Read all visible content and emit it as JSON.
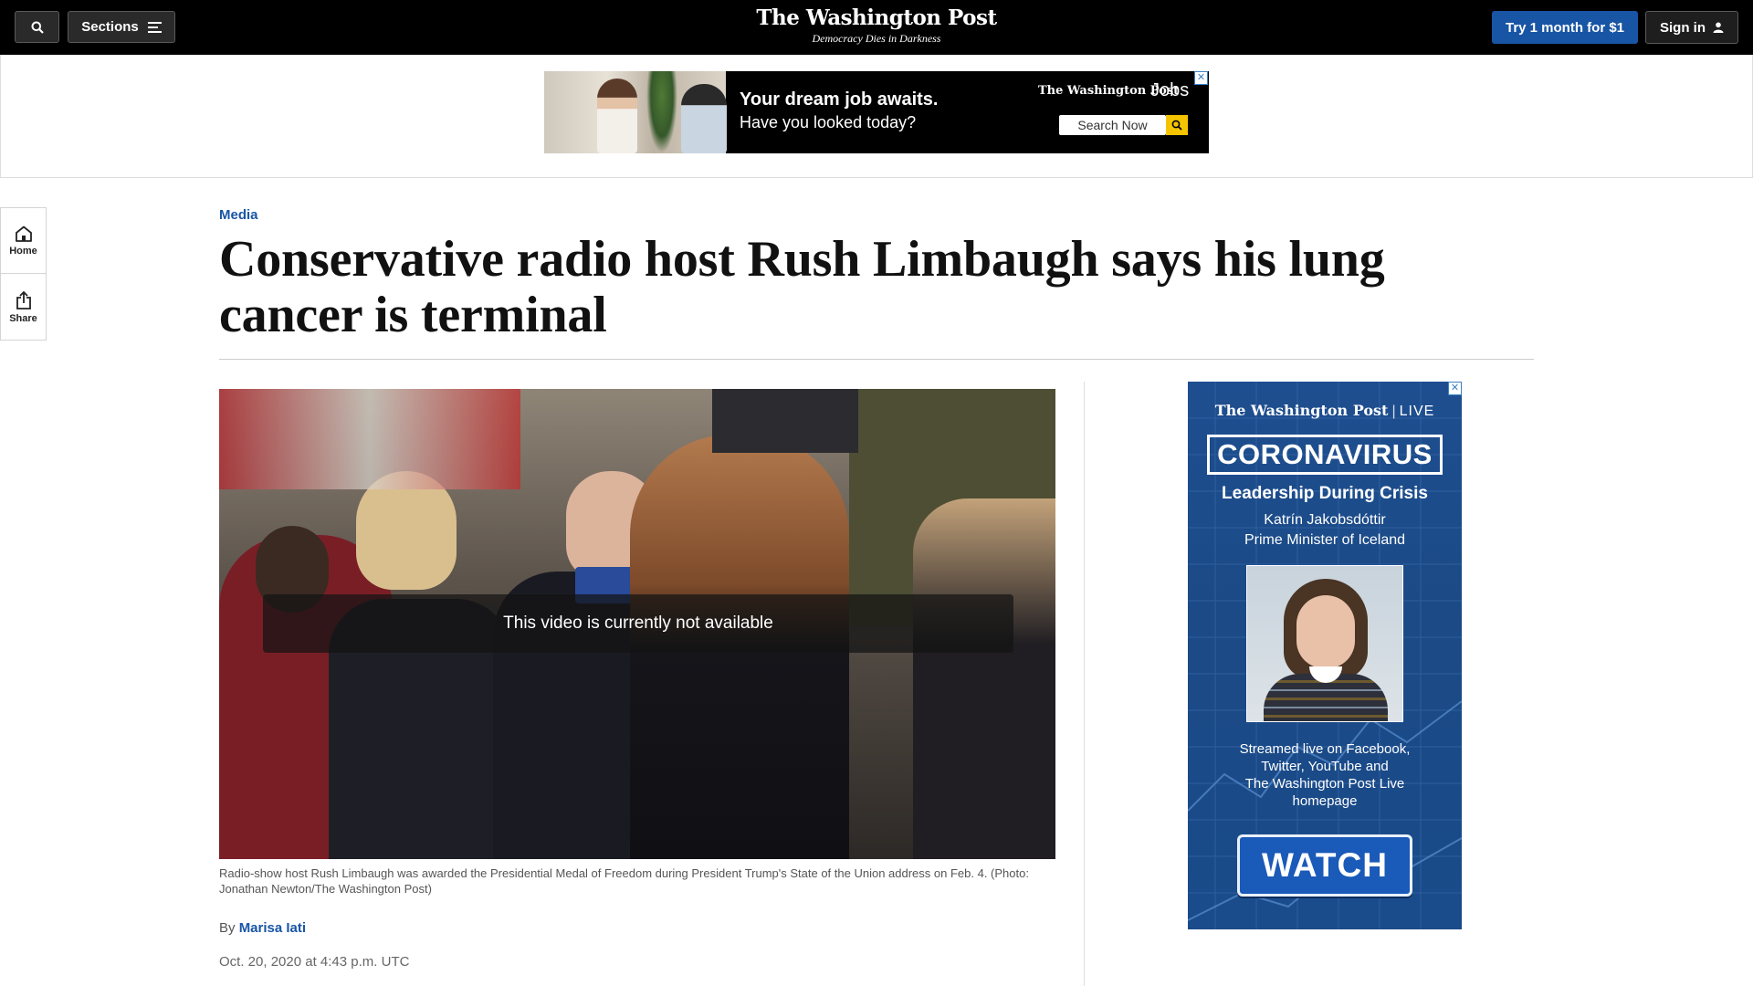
{
  "topbar": {
    "sections_label": "Sections",
    "logo": "The Washington Post",
    "tagline": "Democracy Dies in Darkness",
    "subscribe_label": "Try 1 month for $1",
    "signin_label": "Sign in"
  },
  "top_ad": {
    "headline": "Your dream job awaits.",
    "subline": "Have you looked today?",
    "brand": "The Washington Post",
    "brand_product": "Jobs",
    "search_label": "Search Now",
    "close_glyph": "✕"
  },
  "rail": {
    "home_label": "Home",
    "share_label": "Share"
  },
  "article": {
    "kicker": "Media",
    "headline": "Conservative radio host Rush Limbaugh says his lung cancer is terminal",
    "video_message": "This video is currently not available",
    "caption": "Radio-show host Rush Limbaugh was awarded the Presidential Medal of Freedom during President Trump's State of the Union address on Feb. 4. (Photo: Jonathan Newton/The Washington Post)",
    "byline_prefix": "By",
    "author": "Marisa Iati",
    "date": "Oct. 20, 2020 at 4:43 p.m. UTC"
  },
  "side_ad": {
    "brand": "The Washington Post",
    "brand_separator": "|",
    "brand_live": "LIVE",
    "topic": "CORONAVIRUS",
    "title": "Leadership During Crisis",
    "guest_name": "Katrín Jakobsdóttir",
    "guest_role": "Prime Minister of Iceland",
    "stream_line1": "Streamed live on Facebook,",
    "stream_line2": "Twitter, YouTube and",
    "stream_line3": "The Washington Post Live",
    "stream_line4": "homepage",
    "watch_label": "WATCH",
    "close_glyph": "✕"
  },
  "colors": {
    "accent_blue": "#1955a5",
    "topbar_bg": "#000000",
    "ad_blue": "#1b4a86",
    "jobs_yellow": "#f4c400"
  },
  "icons": [
    "search-icon",
    "menu-icon",
    "user-icon",
    "home-icon",
    "share-icon",
    "close-icon"
  ]
}
